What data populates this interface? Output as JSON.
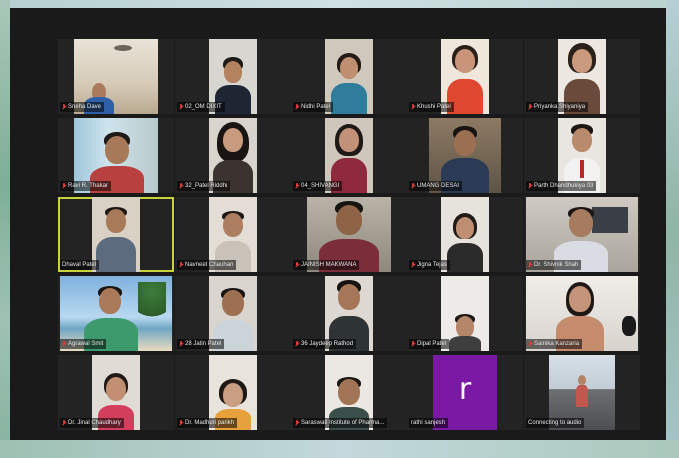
{
  "meeting": {
    "participants": [
      {
        "name": "Sneha Dave",
        "muted": true
      },
      {
        "name": "02_OM DIXIT",
        "muted": true
      },
      {
        "name": "Nidhi Patel",
        "muted": true
      },
      {
        "name": "Khushi Patel",
        "muted": true
      },
      {
        "name": "Priyanka Shiyaniya",
        "muted": true
      },
      {
        "name": "Ravi R. Thakar",
        "muted": true
      },
      {
        "name": "32_Patel Riddhi",
        "muted": true
      },
      {
        "name": "04_SHIVANGI",
        "muted": true
      },
      {
        "name": "UMANG DESAI",
        "muted": true
      },
      {
        "name": "Parth Dhandhukiya 03",
        "muted": true
      },
      {
        "name": "Dhaval Patel",
        "muted": false,
        "active_speaker": true
      },
      {
        "name": "Navneet Chauhan",
        "muted": true
      },
      {
        "name": "JAINISH MAKWANA",
        "muted": true
      },
      {
        "name": "Jigna Tejas",
        "muted": true
      },
      {
        "name": "Dr. Shivnik Shah",
        "muted": true
      },
      {
        "name": "Agrawal Smit",
        "muted": true
      },
      {
        "name": "28 Jatin Patel",
        "muted": true
      },
      {
        "name": "36 Jaydeep Rathod",
        "muted": true
      },
      {
        "name": "Dipal Patel",
        "muted": true
      },
      {
        "name": "Sainika Kanzaria",
        "muted": true
      },
      {
        "name": "Dr. Jinal Chaudhary",
        "muted": true
      },
      {
        "name": "Dr. Madhuri parikh",
        "muted": true
      },
      {
        "name": "Saraswati Institute of Pharma...",
        "muted": true
      },
      {
        "name": "rathi sanjesh",
        "muted": false,
        "avatar_letter": "r",
        "avatar_color": "#7a19a4"
      },
      {
        "name": "Connecting to audio",
        "muted": false
      }
    ]
  }
}
